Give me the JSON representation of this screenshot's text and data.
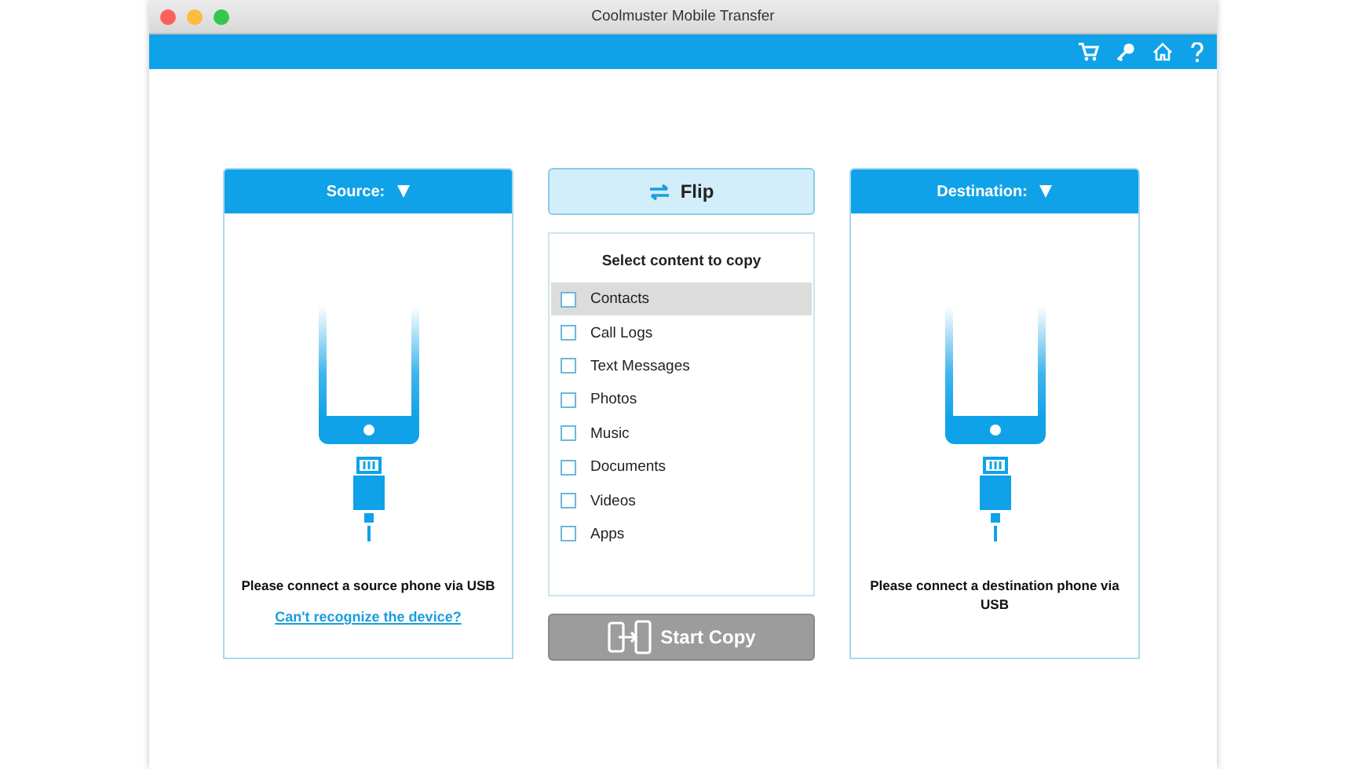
{
  "window": {
    "title": "Coolmuster Mobile Transfer"
  },
  "source_panel": {
    "header": "Source:",
    "message": "Please connect a source phone via USB",
    "link": "Can't recognize the device?"
  },
  "flip_button": {
    "label": "Flip"
  },
  "content_list": {
    "title": "Select content to copy",
    "items": [
      {
        "label": "Contacts",
        "checked": false,
        "selected": true
      },
      {
        "label": "Call Logs",
        "checked": false,
        "selected": false
      },
      {
        "label": "Text Messages",
        "checked": false,
        "selected": false
      },
      {
        "label": "Photos",
        "checked": false,
        "selected": false
      },
      {
        "label": "Music",
        "checked": false,
        "selected": false
      },
      {
        "label": "Documents",
        "checked": false,
        "selected": false
      },
      {
        "label": "Videos",
        "checked": false,
        "selected": false
      },
      {
        "label": "Apps",
        "checked": false,
        "selected": false
      }
    ]
  },
  "start_copy_button": {
    "label": "Start Copy",
    "disabled": true
  },
  "destination_panel": {
    "header": "Destination:",
    "message": "Please connect a destination phone via USB"
  }
}
